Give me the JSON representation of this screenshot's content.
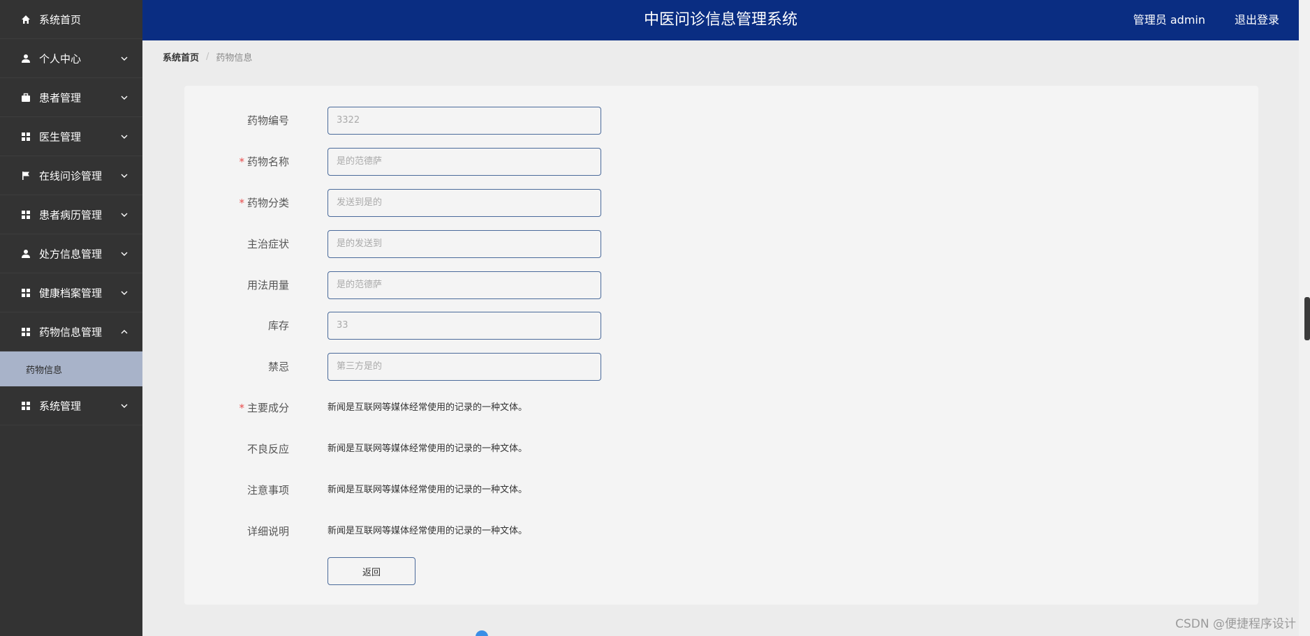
{
  "header": {
    "title": "中医问诊信息管理系统",
    "user": "管理员 admin",
    "logout": "退出登录"
  },
  "sidebar": {
    "items": [
      {
        "label": "系统首页",
        "icon": "home-icon"
      },
      {
        "label": "个人中心",
        "icon": "user-icon"
      },
      {
        "label": "患者管理",
        "icon": "briefcase-icon"
      },
      {
        "label": "医生管理",
        "icon": "grid-icon"
      },
      {
        "label": "在线问诊管理",
        "icon": "flag-icon"
      },
      {
        "label": "患者病历管理",
        "icon": "grid-icon"
      },
      {
        "label": "处方信息管理",
        "icon": "user-icon"
      },
      {
        "label": "健康档案管理",
        "icon": "grid-icon"
      },
      {
        "label": "药物信息管理",
        "icon": "grid-icon"
      },
      {
        "label": "系统管理",
        "icon": "grid-icon"
      }
    ],
    "sub_item": "药物信息"
  },
  "breadcrumb": {
    "home": "系统首页",
    "separator": "/",
    "current": "药物信息"
  },
  "form": {
    "drug_code": {
      "label": "药物编号",
      "value": "3322"
    },
    "drug_name": {
      "label": "药物名称",
      "value": "是的范德萨"
    },
    "drug_category": {
      "label": "药物分类",
      "value": "发送到是的"
    },
    "indications": {
      "label": "主治症状",
      "value": "是的发送到"
    },
    "dosage": {
      "label": "用法用量",
      "value": "是的范德萨"
    },
    "stock": {
      "label": "库存",
      "value": "33"
    },
    "contraindications": {
      "label": "禁忌",
      "value": "第三方是的"
    },
    "ingredients": {
      "label": "主要成分",
      "value": "新闻是互联网等媒体经常使用的记录的一种文体。"
    },
    "side_effects": {
      "label": "不良反应",
      "value": "新闻是互联网等媒体经常使用的记录的一种文体。"
    },
    "precautions": {
      "label": "注意事项",
      "value": "新闻是互联网等媒体经常使用的记录的一种文体。"
    },
    "details": {
      "label": "详细说明",
      "value": "新闻是互联网等媒体经常使用的记录的一种文体。"
    },
    "required_mark": "*",
    "back_label": "返回"
  },
  "watermark": "CSDN @便捷程序设计",
  "colors": {
    "sidebar_bg": "#333333",
    "header_bg": "#0a2d82",
    "active_sub_bg": "#a8b3c9",
    "required": "#e84c4c"
  }
}
